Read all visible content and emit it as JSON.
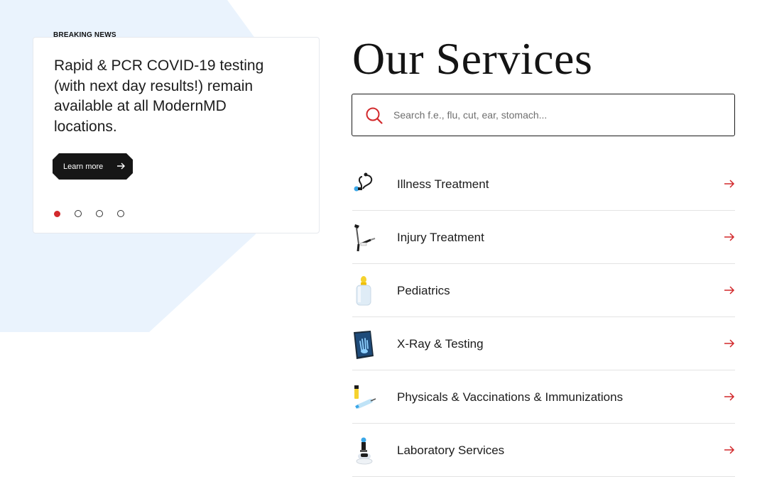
{
  "news": {
    "label": "BREAKING NEWS",
    "text": "Rapid & PCR COVID-19 testing (with next day results!) remain available at all ModernMD locations.",
    "button_label": "Learn more",
    "slides": 4,
    "active_slide": 1
  },
  "services": {
    "title": "Our Services",
    "search_placeholder": "Search f.e., flu, cut, ear, stomach...",
    "items": [
      {
        "label": "Illness Treatment",
        "icon": "stethoscope-icon"
      },
      {
        "label": "Injury Treatment",
        "icon": "crutches-icon"
      },
      {
        "label": "Pediatrics",
        "icon": "baby-bottle-icon"
      },
      {
        "label": "X-Ray & Testing",
        "icon": "xray-icon"
      },
      {
        "label": "Physicals & Vaccinations & Immunizations",
        "icon": "syringe-icon"
      },
      {
        "label": "Laboratory Services",
        "icon": "microscope-icon"
      }
    ]
  },
  "colors": {
    "accent": "#d2292c",
    "dark": "#161616",
    "background_shape": "#eaf3fd"
  }
}
